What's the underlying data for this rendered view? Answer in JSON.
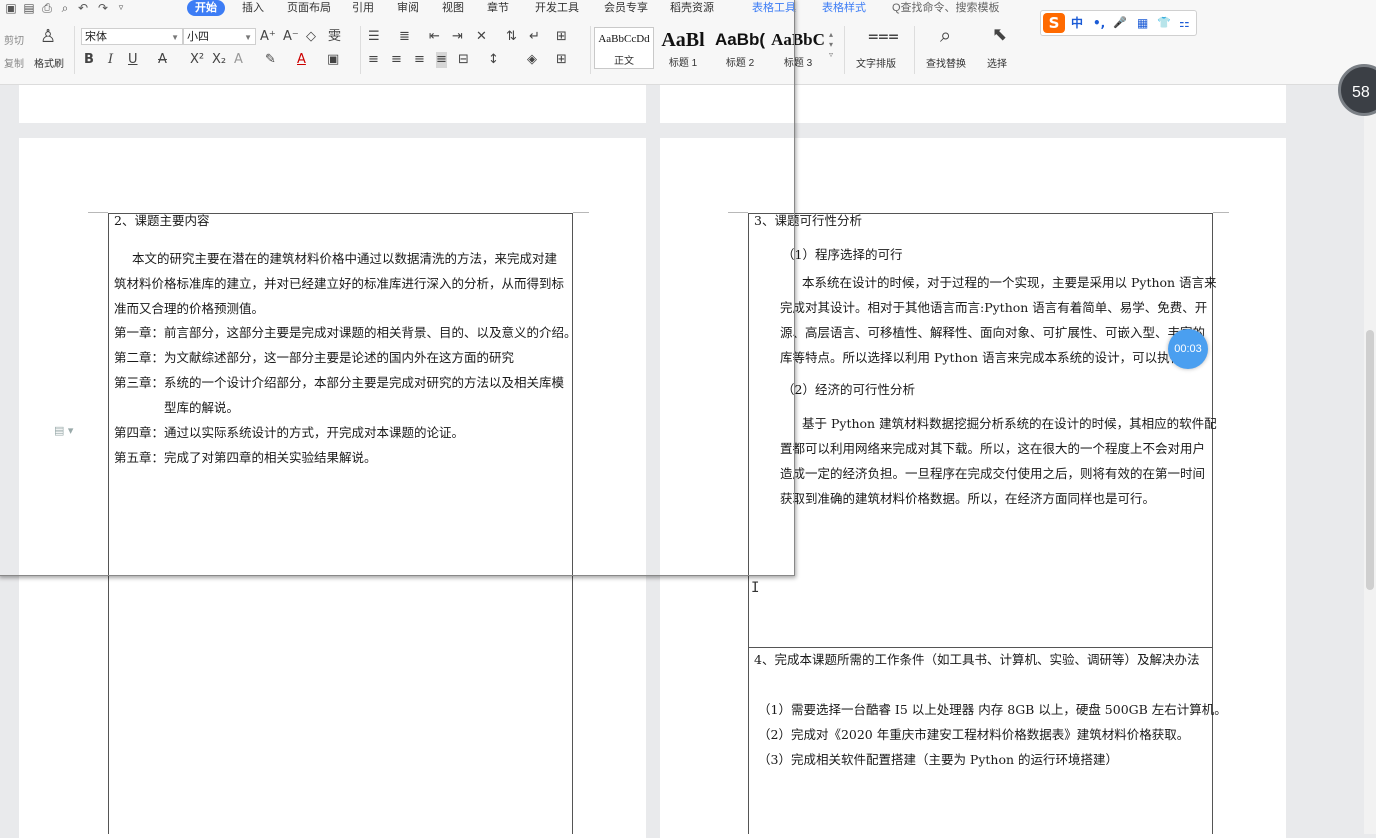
{
  "menubar": {
    "tabs": [
      "开始",
      "插入",
      "页面布局",
      "引用",
      "审阅",
      "视图",
      "章节",
      "开发工具",
      "会员专享",
      "稻壳资源",
      "表格工具",
      "表格样式"
    ],
    "active_tab": "开始",
    "search_placeholder": "Q查找命令、搜索模板"
  },
  "toolbar": {
    "cut": "剪切",
    "copy": "复制",
    "format_painter": "格式刷",
    "font_name": "宋体",
    "font_size": "小四",
    "bold": "B",
    "italic": "I",
    "underline": "U",
    "text_layout": "文字排版",
    "find_replace": "查找替换",
    "select": "选择"
  },
  "styles": [
    {
      "preview": "AaBbCcDd",
      "label": "正文"
    },
    {
      "preview": "AaBl",
      "label": "标题 1"
    },
    {
      "preview": "AaBb(",
      "label": "标题 2"
    },
    {
      "preview": "AaBbC",
      "label": "标题 3"
    }
  ],
  "ime": {
    "logo": "S",
    "mode": "中",
    "punct": "•,",
    "mic": "🎤",
    "grid": "▦",
    "shirt": "👕",
    "tools": "⚏"
  },
  "timer": "00:03",
  "badge": "58",
  "colors": {
    "accent": "#3d7df5",
    "timer": "#4a9ff0",
    "ime_logo": "#ff6a00"
  },
  "left_page": {
    "heading": "2、课题主要内容",
    "intro_lines": [
      "本文的研究主要在潜在的建筑材料价格中通过以数据清洗的方法，来完成对建",
      "筑材料价格标准库的建立，并对已经建立好的标准库进行深入的分析，从而得到标",
      "准而又合理的价格预测值。"
    ],
    "chapters": [
      "第一章：前言部分，这部分主要是完成对课题的相关背景、目的、以及意义的介绍。",
      "第二章：为文献综述部分，这一部分主要是论述的国内外在这方面的研究",
      "第三章：系统的一个设计介绍部分，本部分主要是完成对研究的方法以及相关库模",
      "型库的解说。",
      "第四章：通过以实际系统设计的方式，开完成对本课题的论证。",
      "第五章：完成了对第四章的相关实验结果解说。"
    ]
  },
  "right_page": {
    "heading": "3、课题可行性分析",
    "sub1": "（1）程序选择的可行",
    "para1": [
      "本系统在设计的时候，对于过程的一个实现，主要是采用以 Python 语言来",
      "完成对其设计。相对于其他语言而言:Python 语言有着简单、易学、免费、开",
      "源、高层语言、可移植性、解释性、面向对象、可扩展性、可嵌入型、丰富的",
      "库等特点。所以选择以利用 Python 语言来完成本系统的设计，可以执行。"
    ],
    "sub2": "（2）经济的可行性分析",
    "para2": [
      "基于 Python 建筑材料数据挖掘分析系统的在设计的时候，其相应的软件配",
      "置都可以利用网络来完成对其下载。所以，这在很大的一个程度上不会对用户",
      "造成一定的经济负担。一旦程序在完成交付使用之后，则将有效的在第一时间",
      "获取到准确的建筑材料价格数据。所以，在经济方面同样也是可行。"
    ],
    "heading4": "4、完成本课题所需的工作条件（如工具书、计算机、实验、调研等）及解决办法",
    "items4": [
      "（1）需要选择一台酷睿 I5 以上处理器  内存 8GB 以上，硬盘 500GB 左右计算机。",
      "（2）完成对《2020 年重庆市建安工程材料价格数据表》建筑材料价格获取。",
      "（3）完成相关软件配置搭建（主要为 Python 的运行环境搭建）"
    ]
  }
}
